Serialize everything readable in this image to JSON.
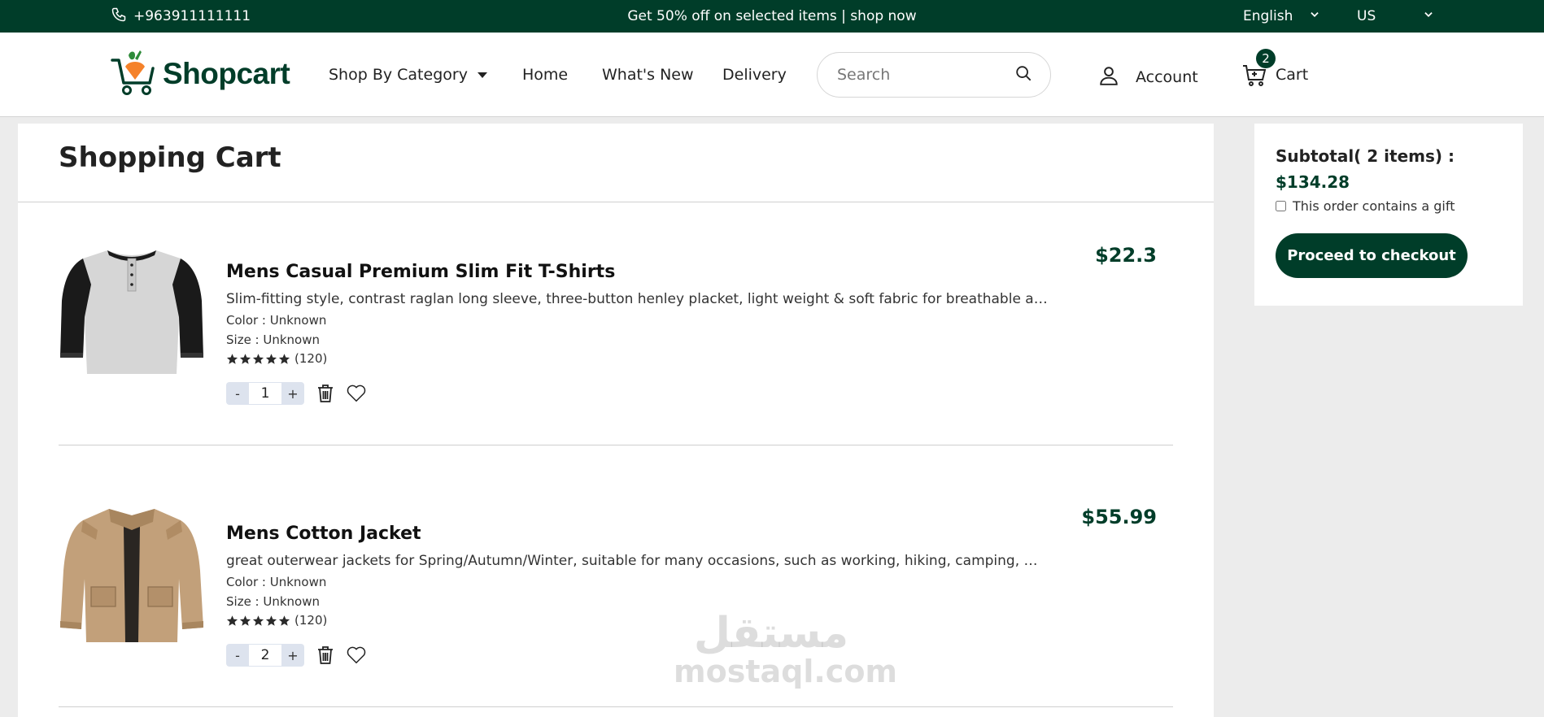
{
  "topbar": {
    "phone": "+963911111111",
    "promo": "Get 50% off on selected items | shop now",
    "language": "English",
    "region": "US"
  },
  "header": {
    "brand": "Shopcart",
    "nav": {
      "category": "Shop By Category",
      "home": "Home",
      "whats_new": "What's New",
      "delivery": "Delivery"
    },
    "search_placeholder": "Search",
    "account": "Account",
    "cart_label": "Cart",
    "cart_count": "2"
  },
  "cart": {
    "title": "Shopping Cart",
    "items": [
      {
        "name": "Mens Casual Premium Slim Fit T-Shirts",
        "description": "Slim-fitting style, contrast raglan long sleeve, three-button henley placket, light weight & soft fabric for breathable and comfortab...",
        "color": "Color : Unknown",
        "size": "Size : Unknown",
        "rating_count": "(120)",
        "rating_stars": 5,
        "quantity": "1",
        "price": "$22.3",
        "minus": "-",
        "plus": "+"
      },
      {
        "name": "Mens Cotton Jacket",
        "description": "great outerwear jackets for Spring/Autumn/Winter, suitable for many occasions, such as working, hiking, camping, mountain/rock...",
        "color": "Color : Unknown",
        "size": "Size : Unknown",
        "rating_count": "(120)",
        "rating_stars": 5,
        "quantity": "2",
        "price": "$55.99",
        "minus": "-",
        "plus": "+"
      }
    ]
  },
  "summary": {
    "subtotal_label": "Subtotal( 2 items) :",
    "subtotal_amount": "$134.28",
    "gift_label": "This order contains a gift",
    "gift_checked": false,
    "checkout_label": "Proceed to checkout"
  },
  "watermark": {
    "arabic": "مستقل",
    "latin": "mostaql.com"
  },
  "colors": {
    "brand_green": "#003d29",
    "accent_orange": "#f5822a",
    "stepper_bg": "#dde3ee",
    "page_bg": "#ececec"
  }
}
